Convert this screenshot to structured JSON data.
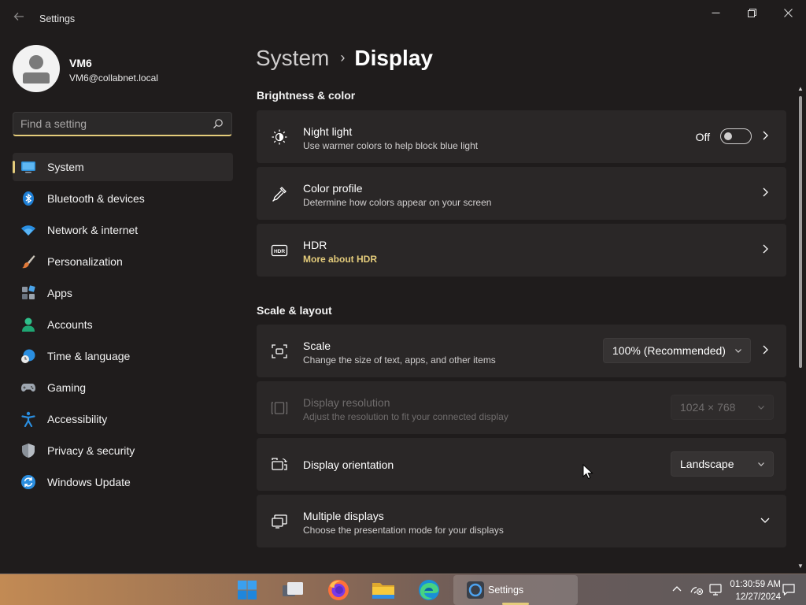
{
  "window": {
    "title": "Settings"
  },
  "profile": {
    "name": "VM6",
    "email": "VM6@collabnet.local"
  },
  "search": {
    "placeholder": "Find a setting",
    "value": ""
  },
  "nav": {
    "items": [
      {
        "label": "System",
        "icon": "system-monitor-icon",
        "active": true
      },
      {
        "label": "Bluetooth & devices",
        "icon": "bluetooth-icon"
      },
      {
        "label": "Network & internet",
        "icon": "wifi-icon"
      },
      {
        "label": "Personalization",
        "icon": "paintbrush-icon"
      },
      {
        "label": "Apps",
        "icon": "apps-icon"
      },
      {
        "label": "Accounts",
        "icon": "accounts-icon"
      },
      {
        "label": "Time & language",
        "icon": "globe-clock-icon"
      },
      {
        "label": "Gaming",
        "icon": "gamepad-icon"
      },
      {
        "label": "Accessibility",
        "icon": "accessibility-icon"
      },
      {
        "label": "Privacy & security",
        "icon": "shield-icon"
      },
      {
        "label": "Windows Update",
        "icon": "windows-update-icon"
      }
    ]
  },
  "breadcrumb": {
    "parent": "System",
    "separator": "›",
    "current": "Display"
  },
  "sections": {
    "brightness": "Brightness & color",
    "scale": "Scale & layout"
  },
  "cards": {
    "night_light": {
      "title": "Night light",
      "desc": "Use warmer colors to help block blue light",
      "toggle_label": "Off",
      "toggle_on": false
    },
    "color_profile": {
      "title": "Color profile",
      "desc": "Determine how colors appear on your screen"
    },
    "hdr": {
      "title": "HDR",
      "link": "More about HDR"
    },
    "scale": {
      "title": "Scale",
      "desc": "Change the size of text, apps, and other items",
      "value": "100% (Recommended)"
    },
    "resolution": {
      "title": "Display resolution",
      "desc": "Adjust the resolution to fit your connected display",
      "value": "1024 × 768",
      "disabled": true
    },
    "orientation": {
      "title": "Display orientation",
      "value": "Landscape"
    },
    "multiple": {
      "title": "Multiple displays",
      "desc": "Choose the presentation mode for your displays"
    }
  },
  "taskbar": {
    "apps": [
      "windows-start-icon",
      "task-view-icon",
      "firefox-icon",
      "file-explorer-icon",
      "edge-icon",
      "settings-icon"
    ],
    "active_app_label": "Settings",
    "time": "01:30:59 AM",
    "date": "12/27/2024"
  },
  "colors": {
    "accent": "#e4cc7b",
    "background": "#1f1c1c",
    "card": "#2a2727"
  }
}
